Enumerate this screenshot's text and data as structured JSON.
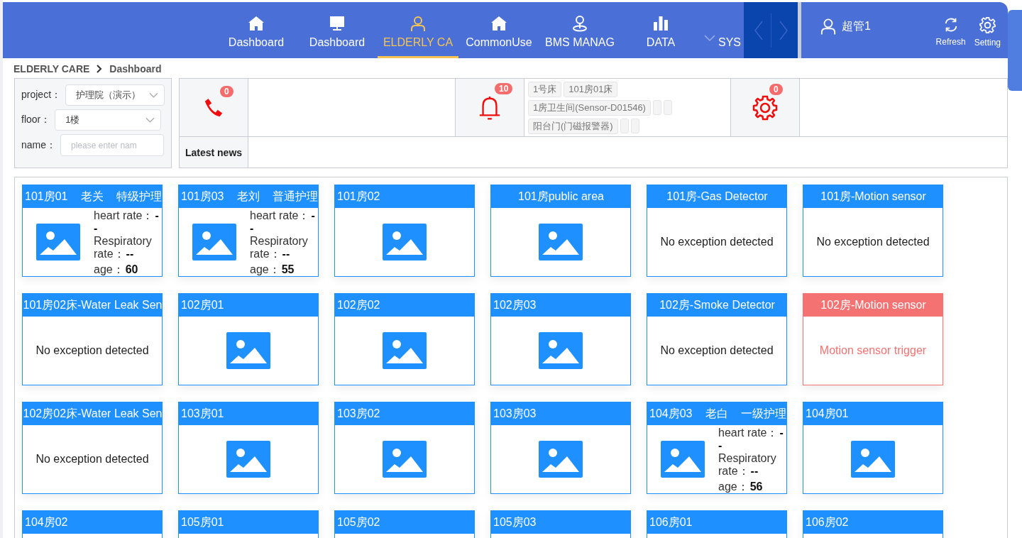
{
  "nav": {
    "items": [
      {
        "label": "Dashboard",
        "kind": "home",
        "selected": false
      },
      {
        "label": "Dashboard",
        "kind": "monitor",
        "selected": false
      },
      {
        "label": "ELDERLY CA",
        "kind": "person",
        "selected": true
      },
      {
        "label": "CommonUse",
        "kind": "home",
        "selected": false
      },
      {
        "label": "BMS MANAG",
        "kind": "pin",
        "selected": false
      },
      {
        "label": "DATA",
        "kind": "chart",
        "selected": false
      },
      {
        "label": "SYS",
        "kind": "none",
        "selected": false
      }
    ],
    "user": "超管1",
    "actions": [
      {
        "label": "Refresh",
        "kind": "refresh"
      },
      {
        "label": "Setting",
        "kind": "gear"
      }
    ]
  },
  "breadcrumb": [
    "ELDERLY CARE",
    "Dashboard"
  ],
  "filters": [
    {
      "label": "project：",
      "kind": "select",
      "value": "护理院（演示）"
    },
    {
      "label": "floor：",
      "kind": "select",
      "value": "1楼"
    },
    {
      "label": "name：",
      "kind": "input",
      "placeholder": "please enter nam"
    }
  ],
  "alerts": [
    {
      "kind": "phone",
      "count": "0"
    },
    {
      "kind": "bell",
      "count": "10",
      "tags": [
        {
          "kind": "label",
          "text": "1号床"
        },
        {
          "kind": "label",
          "text": "101房01床"
        },
        {
          "kind": "label",
          "text": "1房卫生间(Sensor-D01546)"
        },
        {
          "kind": "blank"
        },
        {
          "kind": "blank"
        },
        {
          "kind": "label",
          "text": "阳台门(门磁报警器)"
        },
        {
          "kind": "blank"
        },
        {
          "kind": "blank"
        }
      ]
    },
    {
      "kind": "gear",
      "count": "0"
    }
  ],
  "latest_news": {
    "label": "Latest news"
  },
  "cards": [
    {
      "kind": "resident",
      "title": "101房01",
      "resident": "老关",
      "care_level": "特级护理",
      "vitals": [
        {
          "label": "heart rate：",
          "value": "--"
        },
        {
          "label": "Respiratory rate：",
          "value": "--"
        },
        {
          "label": "age：",
          "value": "60"
        }
      ]
    },
    {
      "kind": "resident",
      "title": "101房03",
      "resident": "老刘",
      "care_level": "普通护理",
      "vitals": [
        {
          "label": "heart rate：",
          "value": "--"
        },
        {
          "label": "Respiratory rate：",
          "value": "--"
        },
        {
          "label": "age：",
          "value": "55"
        }
      ]
    },
    {
      "kind": "room",
      "title": "101房02"
    },
    {
      "kind": "area",
      "title": "101房public area"
    },
    {
      "kind": "sensor",
      "title": "101房-Gas Detector",
      "message": "No exception detected",
      "alarm": false
    },
    {
      "kind": "sensor",
      "title": "101房-Motion sensor",
      "message": "No exception detected",
      "alarm": false
    },
    {
      "kind": "sensor",
      "title": "101房02床-Water Leak Sen",
      "message": "No exception detected",
      "alarm": false
    },
    {
      "kind": "room",
      "title": "102房01"
    },
    {
      "kind": "room",
      "title": "102房02"
    },
    {
      "kind": "room",
      "title": "102房03"
    },
    {
      "kind": "sensor",
      "title": "102房-Smoke Detector",
      "message": "No exception detected",
      "alarm": false
    },
    {
      "kind": "sensor",
      "title": "102房-Motion sensor",
      "message": "Motion sensor trigger",
      "alarm": true
    },
    {
      "kind": "sensor",
      "title": "102房02床-Water Leak Sen",
      "message": "No exception detected",
      "alarm": false
    },
    {
      "kind": "room",
      "title": "103房01"
    },
    {
      "kind": "room",
      "title": "103房02"
    },
    {
      "kind": "room",
      "title": "103房03"
    },
    {
      "kind": "resident",
      "title": "104房03",
      "resident": "老白",
      "care_level": "一级护理",
      "vitals": [
        {
          "label": "heart rate：",
          "value": "--"
        },
        {
          "label": "Respiratory rate：",
          "value": "--"
        },
        {
          "label": "age：",
          "value": "56"
        }
      ]
    },
    {
      "kind": "room",
      "title": "104房01"
    },
    {
      "kind": "room",
      "title": "104房02"
    },
    {
      "kind": "room",
      "title": "105房01"
    },
    {
      "kind": "room",
      "title": "105房02"
    },
    {
      "kind": "room",
      "title": "105房03"
    },
    {
      "kind": "room",
      "title": "106房01"
    },
    {
      "kind": "room",
      "title": "106房02"
    }
  ]
}
